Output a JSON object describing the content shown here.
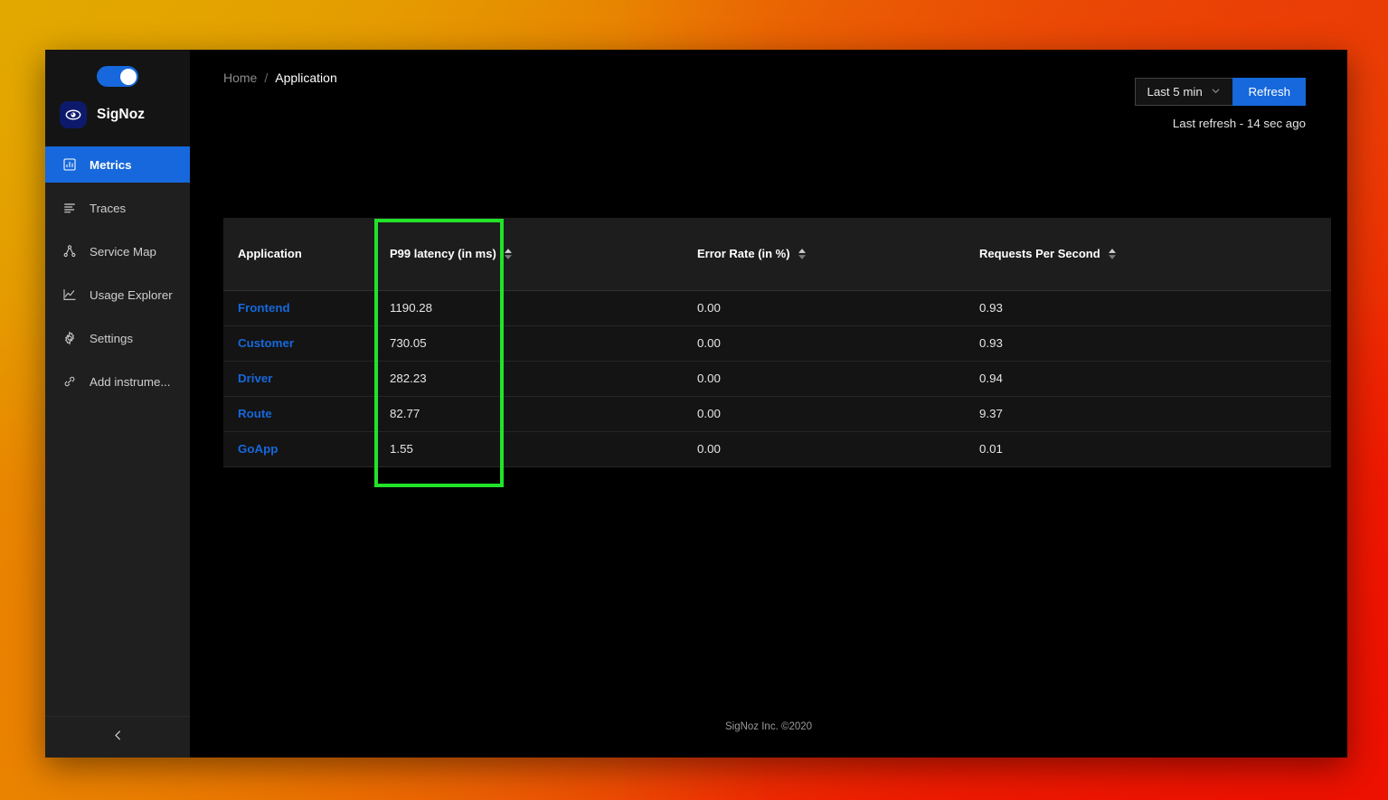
{
  "sidebar": {
    "theme_toggle": {
      "name": "dark-mode-toggle",
      "state": "on"
    },
    "brand": {
      "name": "SigNoz",
      "icon": "eye-icon"
    },
    "items": [
      {
        "label": "Metrics",
        "icon": "bar-chart-icon",
        "active": true
      },
      {
        "label": "Traces",
        "icon": "list-lines-icon",
        "active": false
      },
      {
        "label": "Service Map",
        "icon": "node-graph-icon",
        "active": false
      },
      {
        "label": "Usage Explorer",
        "icon": "line-chart-icon",
        "active": false
      },
      {
        "label": "Settings",
        "icon": "gear-icon",
        "active": false
      },
      {
        "label": "Add instrume...",
        "icon": "link-chain-icon",
        "active": false
      }
    ],
    "collapse_icon": "chevron-left-icon"
  },
  "breadcrumb": {
    "home": "Home",
    "separator": "/",
    "current": "Application"
  },
  "toolbar": {
    "time_range_value": "Last 5 min",
    "time_range_icon": "chevron-down-icon",
    "refresh_label": "Refresh",
    "last_refresh": "Last refresh - 14 sec ago"
  },
  "table": {
    "columns": [
      {
        "label": "Application",
        "sortable": false
      },
      {
        "label": "P99 latency (in ms)",
        "sortable": true
      },
      {
        "label": "Error Rate (in %)",
        "sortable": true
      },
      {
        "label": "Requests Per Second",
        "sortable": true
      }
    ],
    "rows": [
      {
        "application": "Frontend",
        "p99": "1190.28",
        "error_rate": "0.00",
        "rps": "0.93"
      },
      {
        "application": "Customer",
        "p99": "730.05",
        "error_rate": "0.00",
        "rps": "0.93"
      },
      {
        "application": "Driver",
        "p99": "282.23",
        "error_rate": "0.00",
        "rps": "0.94"
      },
      {
        "application": "Route",
        "p99": "82.77",
        "error_rate": "0.00",
        "rps": "9.37"
      },
      {
        "application": "GoApp",
        "p99": "1.55",
        "error_rate": "0.00",
        "rps": "0.01"
      }
    ]
  },
  "annotation": {
    "highlight_color": "#22e22a",
    "target": "application-column"
  },
  "footer": {
    "text": "SigNoz Inc. ©2020"
  },
  "colors": {
    "accent_blue": "#1668dc",
    "link_blue": "#1668dc",
    "sidebar_bg": "#1f1f1f",
    "window_bg": "#000000",
    "table_header_bg": "#1d1d1d",
    "table_row_bg": "#141414",
    "highlight_green": "#22e22a"
  }
}
